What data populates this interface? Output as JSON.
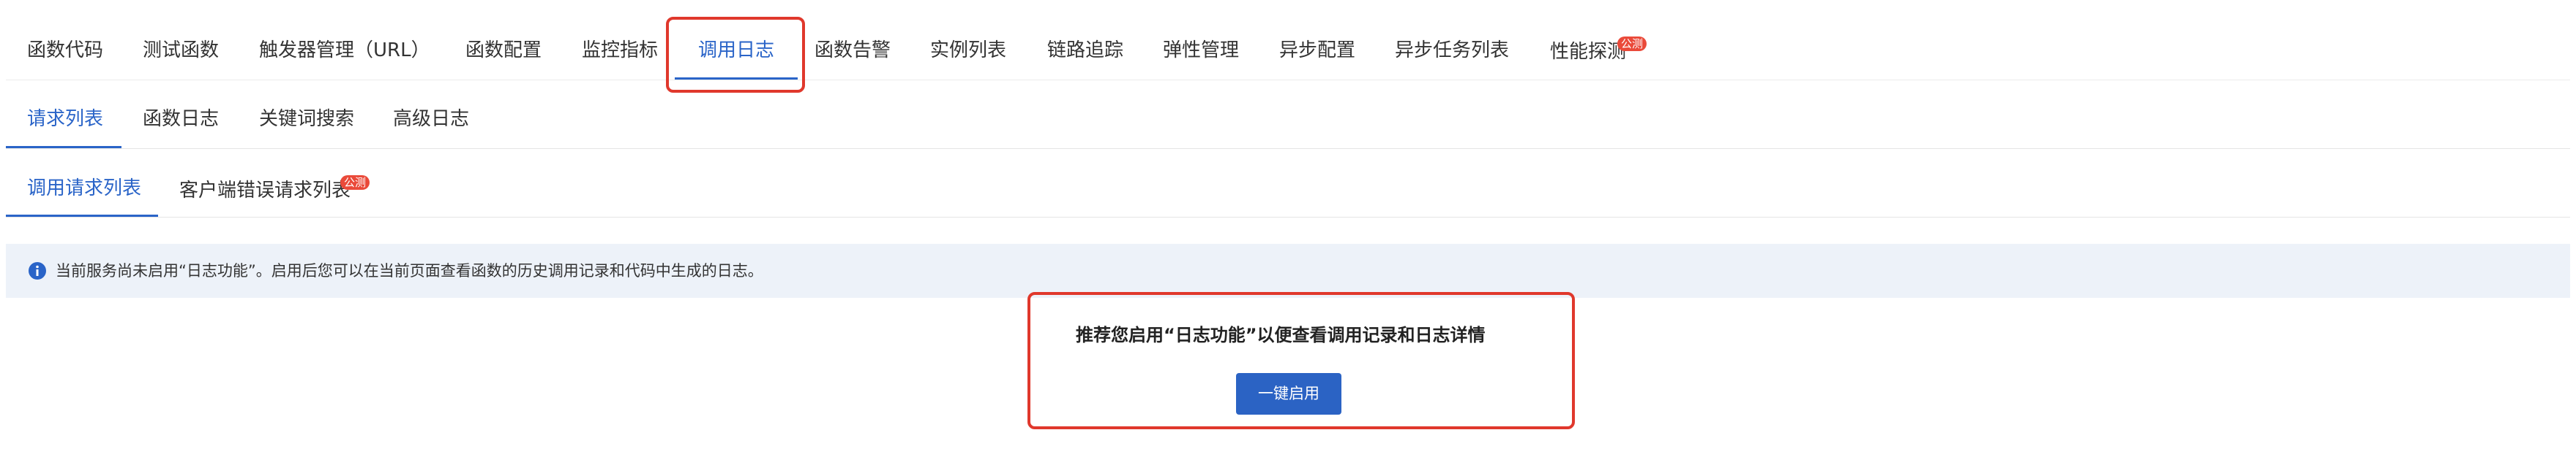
{
  "primary_tabs": [
    {
      "label": "函数代码"
    },
    {
      "label": "测试函数"
    },
    {
      "label": "触发器管理（URL）"
    },
    {
      "label": "函数配置"
    },
    {
      "label": "监控指标"
    },
    {
      "label": "调用日志",
      "active": true
    },
    {
      "label": "函数告警"
    },
    {
      "label": "实例列表"
    },
    {
      "label": "链路追踪"
    },
    {
      "label": "弹性管理"
    },
    {
      "label": "异步配置"
    },
    {
      "label": "异步任务列表"
    },
    {
      "label": "性能探测",
      "badge": "公测"
    }
  ],
  "secondary_tabs": [
    {
      "label": "请求列表",
      "active": true
    },
    {
      "label": "函数日志"
    },
    {
      "label": "关键词搜索"
    },
    {
      "label": "高级日志"
    }
  ],
  "tertiary_tabs": [
    {
      "label": "调用请求列表",
      "active": true
    },
    {
      "label": "客户端错误请求列表",
      "badge": "公测"
    }
  ],
  "notice": {
    "text": "当前服务尚未启用“日志功能”。启用后您可以在当前页面查看函数的历史调用记录和代码中生成的日志。"
  },
  "promo": {
    "title": "推荐您启用“日志功能”以便查看调用记录和日志详情",
    "button_label": "一键启用"
  },
  "colors": {
    "accent": "#2a64c8",
    "highlight_border": "#e0382c",
    "badge": "#ea4a3a",
    "notice_bg": "#edf2f9"
  }
}
